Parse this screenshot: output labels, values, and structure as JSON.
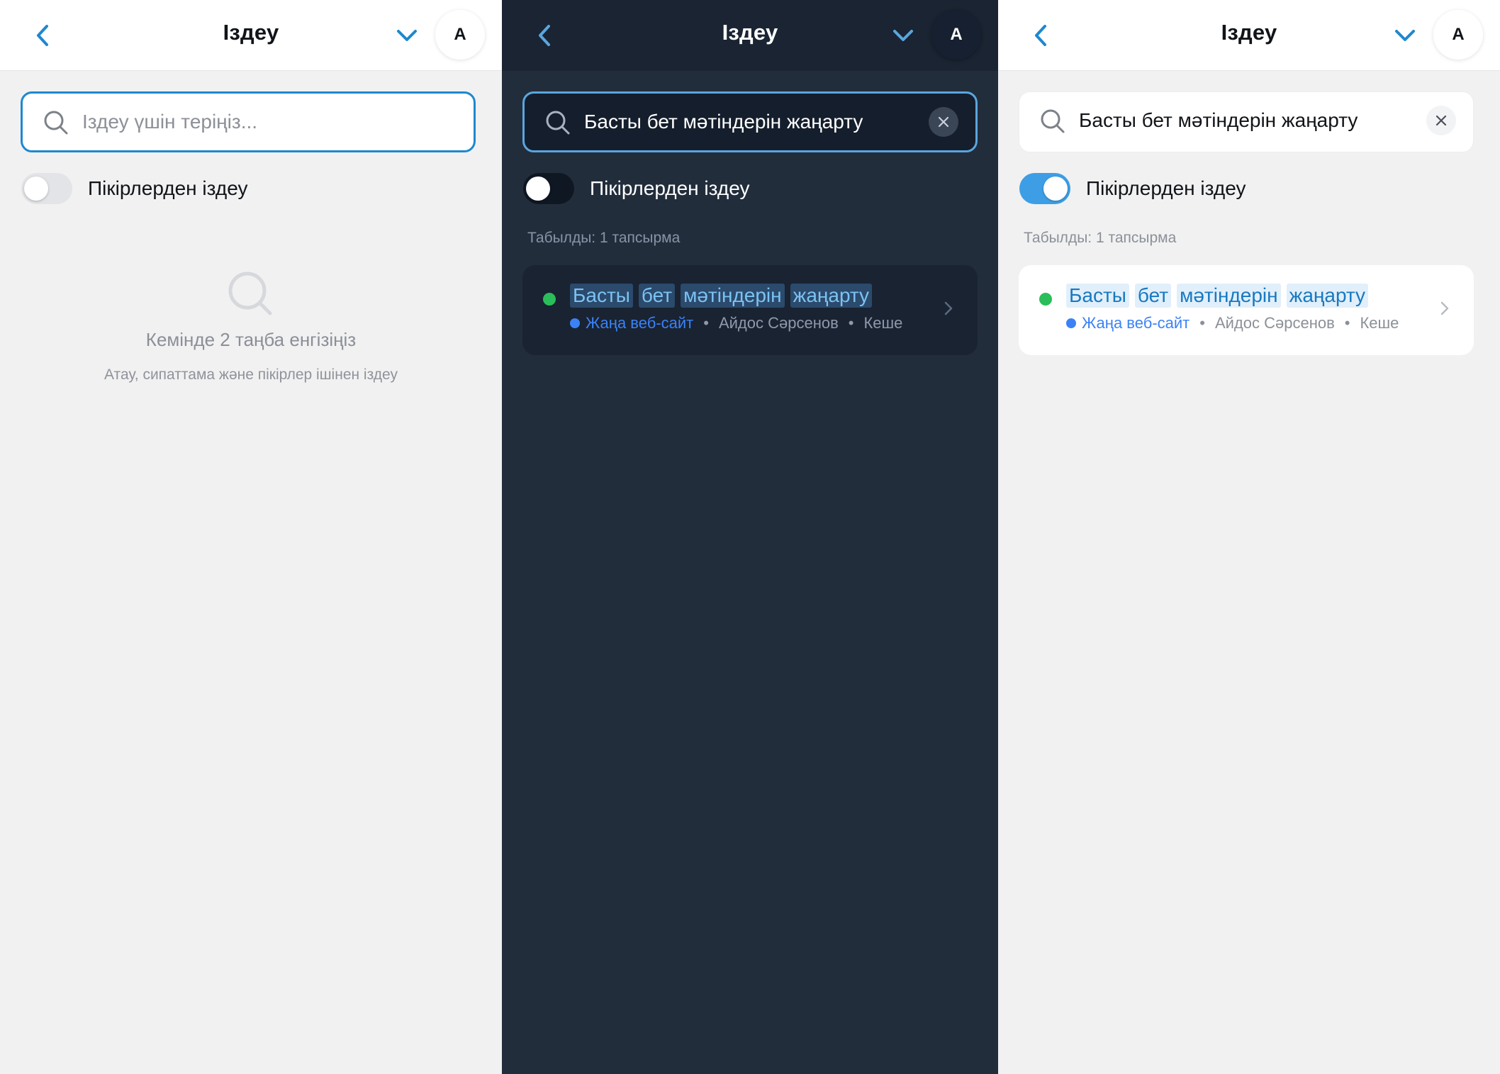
{
  "colors": {
    "accent": "#1e88cf",
    "toggle_on": "#3d9ee6",
    "status_green": "#2bbd5a",
    "project_blue": "#3b82f6",
    "dark_bg": "#222d3c",
    "light_bg": "#f1f1f2"
  },
  "header": {
    "title": "Іздеу",
    "avatar_initial": "A"
  },
  "search": {
    "placeholder": "Іздеу үшін теріңіз...",
    "value": "Басты бет мәтіндерін жаңарту"
  },
  "toggle": {
    "label": "Пікірлерден іздеу"
  },
  "empty_state": {
    "title": "Кемінде 2 таңба енгізіңіз",
    "subtitle": "Атау, сипаттама және пікірлер ішінен іздеу"
  },
  "results": {
    "count_label": "Табылды: 1 тапсырма",
    "task": {
      "title_words": [
        "Басты",
        "бет",
        "мәтіндерін",
        "жаңарту"
      ],
      "project": "Жаңа веб-сайт",
      "assignee": "Айдос Сәрсенов",
      "date": "Кеше",
      "separator": "•"
    }
  },
  "panels": [
    {
      "theme": "light",
      "toggle_on": false,
      "has_query": false
    },
    {
      "theme": "dark",
      "toggle_on": false,
      "has_query": true
    },
    {
      "theme": "light",
      "toggle_on": true,
      "has_query": true
    }
  ]
}
